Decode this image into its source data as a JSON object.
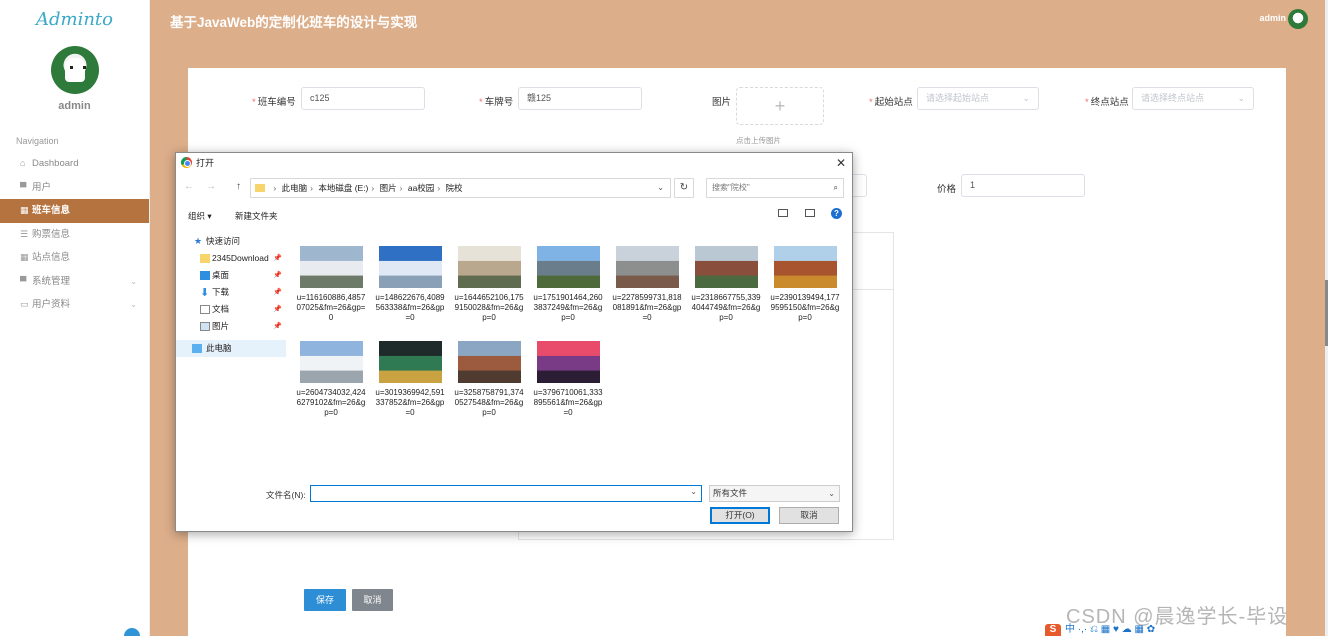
{
  "sidebar": {
    "brand": "Adminto",
    "user": "admin",
    "nav_title": "Navigation",
    "items": [
      {
        "label": "Dashboard",
        "icon": "home-icon"
      },
      {
        "label": "用户",
        "icon": "user-icon"
      },
      {
        "label": "班车信息",
        "icon": "grid-icon"
      },
      {
        "label": "购票信息",
        "icon": "list-icon"
      },
      {
        "label": "站点信息",
        "icon": "grid-icon"
      },
      {
        "label": "系统管理",
        "icon": "user-icon"
      },
      {
        "label": "用户资料",
        "icon": "card-icon"
      }
    ]
  },
  "topbar": {
    "title": "基于JavaWeb的定制化班车的设计与实现",
    "user": "admin"
  },
  "form": {
    "bus_no_label": "班车编号",
    "bus_no_value": "c125",
    "plate_label": "车牌号",
    "plate_value": "赣125",
    "image_label": "图片",
    "upload_plus": "+",
    "upload_tip": "点击上传图片",
    "start_label": "起始站点",
    "start_placeholder": "请选择起始站点",
    "end_label": "终点站点",
    "end_placeholder": "请选择终点站点",
    "price_label": "价格",
    "price_value": "1",
    "save": "保存",
    "cancel": "取消"
  },
  "dialog": {
    "title": "打开",
    "path": [
      "此电脑",
      "本地磁盘 (E:)",
      "图片",
      "aa校园",
      "院校"
    ],
    "search_placeholder": "搜索\"院校\"",
    "organize": "组织 ▾",
    "new_folder": "新建文件夹",
    "tree": [
      {
        "label": "快速访问"
      },
      {
        "label": "2345Download"
      },
      {
        "label": "桌面"
      },
      {
        "label": "下载"
      },
      {
        "label": "文档"
      },
      {
        "label": "图片"
      },
      {
        "label": "此电脑"
      }
    ],
    "files": [
      {
        "name": "u=116160886,485707025&fm=26&gp=0",
        "colors": [
          "#9fb6cf",
          "#e8ecf0",
          "#6d7a6a"
        ]
      },
      {
        "name": "u=148622676,4089563338&fm=26&gp=0",
        "colors": [
          "#2f6fc4",
          "#dfe8f4",
          "#8aa0b6"
        ]
      },
      {
        "name": "u=1644652106,1759150028&fm=26&gp=0",
        "colors": [
          "#e7e2d8",
          "#b9a88e",
          "#5f6c4f"
        ]
      },
      {
        "name": "u=1751901464,2603837249&fm=26&gp=0",
        "colors": [
          "#7fb3e6",
          "#6a7d8a",
          "#4e6a3a"
        ]
      },
      {
        "name": "u=2278599731,818081891&fm=26&gp=0",
        "colors": [
          "#c9d2db",
          "#8c8f8d",
          "#7a5a4a"
        ]
      },
      {
        "name": "u=2318667755,3394044749&fm=26&gp=0",
        "colors": [
          "#b9c8d3",
          "#8a4e3c",
          "#4b6a3f"
        ]
      },
      {
        "name": "u=2390139494,1779595150&fm=26&gp=0",
        "colors": [
          "#b0d0ea",
          "#a8542e",
          "#c98b2e"
        ]
      },
      {
        "name": "u=2604734032,4246279102&fm=26&gp=0",
        "colors": [
          "#8fb4de",
          "#f0f3f6",
          "#9aa5ad"
        ]
      },
      {
        "name": "u=3019369942,591337852&fm=26&gp=0",
        "colors": [
          "#1e2b2a",
          "#2f7a52",
          "#c9a241"
        ]
      },
      {
        "name": "u=3258758791,3740527548&fm=26&gp=0",
        "colors": [
          "#8aa6c2",
          "#9c5a3f",
          "#4f3b30"
        ]
      },
      {
        "name": "u=3796710061,333895561&fm=26&gp=0",
        "colors": [
          "#e94c6b",
          "#7a3b86",
          "#2b1d33"
        ]
      }
    ],
    "filename_label": "文件名(N):",
    "filename_value": "",
    "filetype": "所有文件",
    "open_btn": "打开(O)",
    "cancel_btn": "取消"
  },
  "watermark": "CSDN @晨逸学长-毕设",
  "colors": {
    "accent": "#dcae8a",
    "active_nav": "#b5733f",
    "primary_btn": "#2d8ed6"
  }
}
